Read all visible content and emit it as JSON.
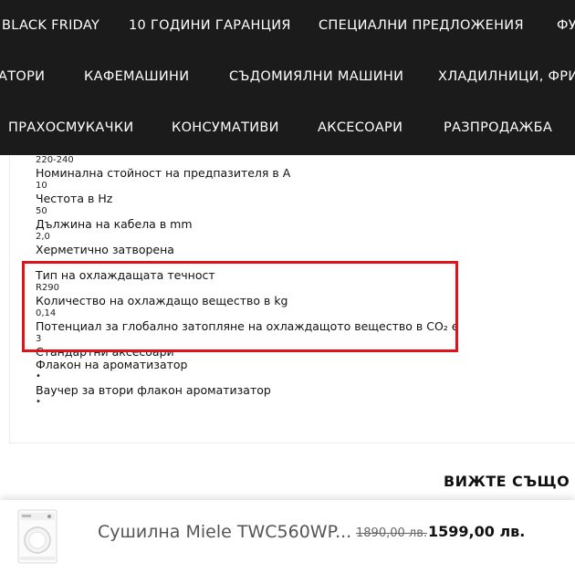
{
  "nav": {
    "row1": [
      "BLACK FRIDAY",
      "10 ГОДИНИ ГАРАНЦИЯ",
      "СПЕЦИАЛНИ ПРЕДЛОЖЕНИЯ",
      "ФУ"
    ],
    "row2": [
      "АТОРИ",
      "КАФЕМАШИНИ",
      "СЪДОМИЯЛНИ МАШИНИ",
      "ХЛАДИЛНИЦИ, ФРИЗЕ"
    ],
    "row3": [
      "ПРАХОСМУКАЧКИ",
      "КОНСУМАТИВИ",
      "АКСЕСОАРИ",
      "РАЗПРОДАЖБА"
    ]
  },
  "specs": {
    "voltage_value": "220-240",
    "fuse_label": "Номинална стойност на предпазителя в A",
    "fuse_value": "10",
    "frequency_label": "Честота в Hz",
    "frequency_value": "50",
    "cable_label": "Дължина на кабела в mm",
    "cable_value": "2,0",
    "hermetic_label": "Херметично затворена",
    "coolant_type_label": "Тип на охлаждащата течност",
    "coolant_type_value": "R290",
    "coolant_amount_label": "Количество на охлаждащо вещество в kg",
    "coolant_amount_value": "0,14",
    "gwp_label": "Потенциал за глобално затопляне на охлаждащото вещество в CO₂ e",
    "gwp_value": "3",
    "accessories_label": "Стандартни аксесоари",
    "flacon_label": "Флакон на ароматизатор",
    "bullet": "•",
    "voucher_label": "Ваучер за втори флакон ароматизатор"
  },
  "see_also": "ВИЖТЕ СЪЩО И",
  "product_bar": {
    "title": "Сушилна Miele TWC560WP...",
    "old_price": "1890,00 лв.",
    "new_price": "1599,00 лв."
  },
  "colors": {
    "nav_background": "#1b1b1b",
    "highlight": "#e0121a"
  },
  "icons": {
    "product_thumbnail": "dryer-image"
  }
}
